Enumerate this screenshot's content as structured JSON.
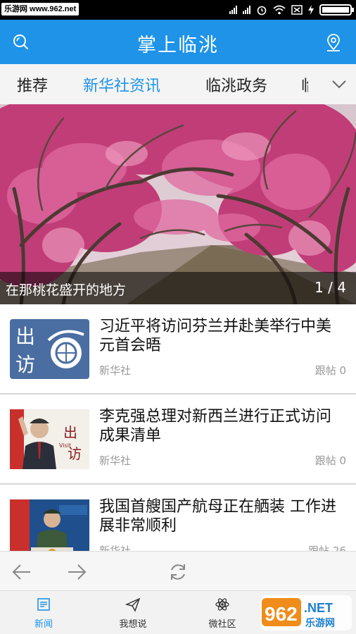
{
  "status_bar": {
    "watermark": "乐游网 www.962.net"
  },
  "header": {
    "title": "掌上临洮",
    "left_icon": "search-icon",
    "right_icon": "location-pin-icon"
  },
  "tabs": {
    "items": [
      {
        "label": "推荐",
        "active": false
      },
      {
        "label": "新华社资讯",
        "active": true
      },
      {
        "label": "临洮政务",
        "active": false
      },
      {
        "label": "临洮",
        "active": false
      }
    ],
    "more_icon": "chevron-down-icon"
  },
  "banner": {
    "caption": "在那桃花盛开的地方",
    "pager": "1 / 4"
  },
  "news": [
    {
      "headline": "习近平将访问芬兰并赴美举行中美元首会晤",
      "source": "新华社",
      "reply": "跟帖 0"
    },
    {
      "headline": "李克强总理对新西兰进行正式访问成果清单",
      "source": "新华社",
      "reply": "跟帖 0"
    },
    {
      "headline": "我国首艘国产航母正在舾装 工作进展非常顺利",
      "source": "新华社",
      "reply": "跟帖 26"
    }
  ],
  "thumb_text": {
    "chufang_1": "出",
    "chufang_2": "访",
    "visit": "Visit"
  },
  "tabbar": {
    "items": [
      {
        "label": "新闻",
        "icon": "news-icon",
        "active": true
      },
      {
        "label": "我想说",
        "icon": "paper-plane-icon",
        "active": false
      },
      {
        "label": "微社区",
        "icon": "atom-icon",
        "active": false
      }
    ]
  },
  "logo": {
    "text_962": "962",
    "text_net": ".NET",
    "text_cn": "乐游网"
  },
  "colors": {
    "accent": "#1e93e8",
    "status_bar": "#000000"
  }
}
